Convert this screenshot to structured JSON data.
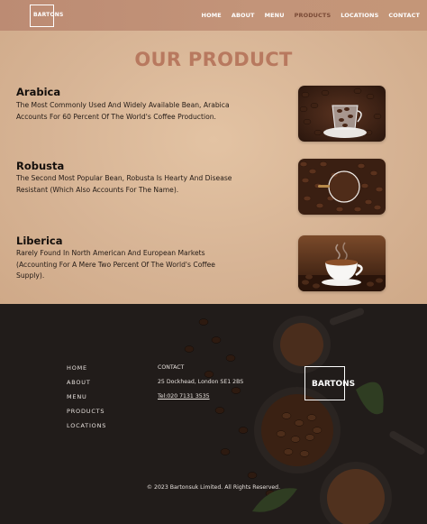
{
  "header": {
    "logo_text": "BARTONS",
    "nav": [
      {
        "label": "HOME"
      },
      {
        "label": "ABOUT"
      },
      {
        "label": "MENU"
      },
      {
        "label": "PRODUCTS",
        "active": true
      },
      {
        "label": "LOCATIONS"
      },
      {
        "label": "CONTACT"
      }
    ],
    "active_color": "#7a4a36"
  },
  "main": {
    "title": "OUR PRODUCT",
    "products": [
      {
        "name": "Arabica",
        "description": "The Most Commonly Used And Widely Available Bean, Arabica Accounts For 60 Percent Of The World's Coffee Production.",
        "image": "coffee-beans-glass-cup"
      },
      {
        "name": "Robusta",
        "description": "The Second Most Popular Bean, Robusta Is Hearty And Disease Resistant (Which Also Accounts For The Name).",
        "image": "coffee-beans-magnifier"
      },
      {
        "name": "Liberica",
        "description": "Rarely Found In North American And European Markets (Accounting For A Mere Two Percent Of The World's Coffee Supply).",
        "image": "coffee-cup-steam"
      }
    ]
  },
  "footer": {
    "links": [
      {
        "label": "HOME"
      },
      {
        "label": "ABOUT"
      },
      {
        "label": "MENU"
      },
      {
        "label": "PRODUCTS"
      },
      {
        "label": "LOCATIONS"
      }
    ],
    "contact": {
      "heading": "CONTACT",
      "address": "25 Dockhead, London SE1 2BS",
      "phone": "Tel:020 7131 3535"
    },
    "logo_text": "BARTONS",
    "copyright": "© 2023 Bartonsuk Limited. All Rights Reserved."
  }
}
